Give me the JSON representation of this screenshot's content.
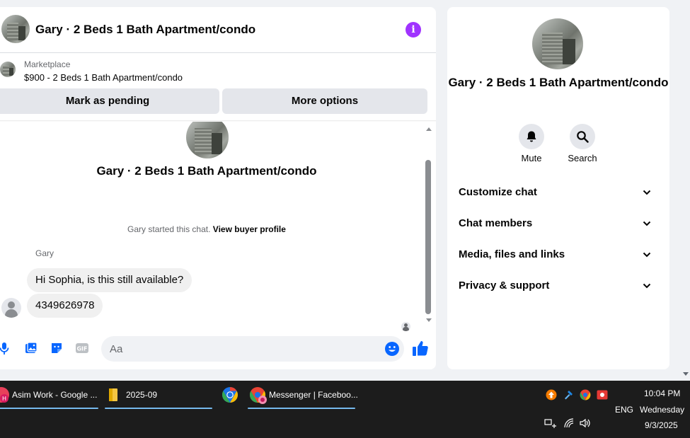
{
  "chat": {
    "header_title": "Gary · 2 Beds 1 Bath Apartment/condo",
    "listing_source": "Marketplace",
    "listing_price_title": "$900 - 2 Beds 1 Bath Apartment/condo",
    "mark_pending_label": "Mark as pending",
    "more_options_label": "More options",
    "conversation_title": "Gary · 2 Beds 1 Bath Apartment/condo",
    "started_text": "Gary started this chat.",
    "view_buyer_profile": "View buyer profile",
    "sender_name": "Gary",
    "messages": [
      "Hi Sophia, is this still available?",
      "4349626978"
    ],
    "composer_placeholder": "Aa"
  },
  "info_panel": {
    "title": "Gary · 2 Beds 1 Bath Apartment/condo",
    "mute_label": "Mute",
    "search_label": "Search",
    "sections": [
      "Customize chat",
      "Chat members",
      "Media, files and links",
      "Privacy & support"
    ]
  },
  "taskbar": {
    "chrome_task": "Asim Work - Google ...",
    "folder_task": "2025-09",
    "messenger_task": "Messenger | Faceboo...",
    "language": "ENG",
    "time": "10:04 PM",
    "day": "Wednesday",
    "date": "9/3/2025"
  },
  "colors": {
    "messenger_accent": "#0866ff",
    "info_icon": "#a033ff",
    "taskbar_bg": "#1c1c1c"
  }
}
